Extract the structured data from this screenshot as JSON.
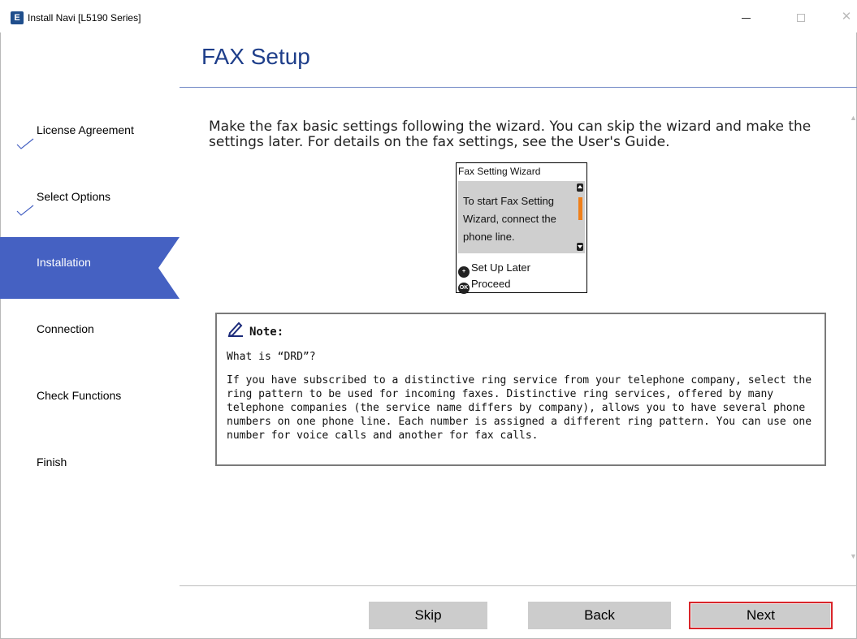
{
  "window": {
    "title": "Install Navi [L5190 Series]",
    "icon_letter": "E",
    "controls": {
      "minimize": "minimize-icon",
      "maximize": "maximize-icon",
      "close": "close-icon"
    }
  },
  "sidebar": {
    "steps": [
      {
        "label": "License Agreement",
        "state": "done"
      },
      {
        "label": "Select Options",
        "state": "done"
      },
      {
        "label": "Installation",
        "state": "active"
      },
      {
        "label": "Connection",
        "state": "pending"
      },
      {
        "label": "Check Functions",
        "state": "pending"
      },
      {
        "label": "Finish",
        "state": "pending"
      }
    ]
  },
  "main": {
    "title": "FAX Setup",
    "intro": "Make the fax basic settings following the wizard. You can skip the wizard and make the settings later. For details on the fax settings, see the User's Guide.",
    "lcd": {
      "header": "Fax Setting Wizard",
      "message": "To start Fax Setting Wizard, connect the phone line.",
      "options": [
        {
          "glyph": "+",
          "label": "Set Up Later"
        },
        {
          "glyph": "OK",
          "label": "Proceed"
        }
      ]
    },
    "note": {
      "title": "Note:",
      "question": "What is “DRD”?",
      "body": "If you have subscribed to a distinctive ring service from your telephone company, select the ring pattern to be used for incoming faxes. Distinctive ring services, offered by many telephone companies (the service name differs by company), allows you to have several phone numbers on one phone line. Each number is assigned a different ring pattern. You can use one number for voice calls and another for fax calls."
    }
  },
  "footer": {
    "skip_label": "Skip",
    "back_label": "Back",
    "next_label": "Next"
  },
  "colors": {
    "accent": "#4561c2",
    "title": "#1e3e8a",
    "next_highlight": "#d9252a",
    "lcd_scroll": "#ef7f1a"
  }
}
